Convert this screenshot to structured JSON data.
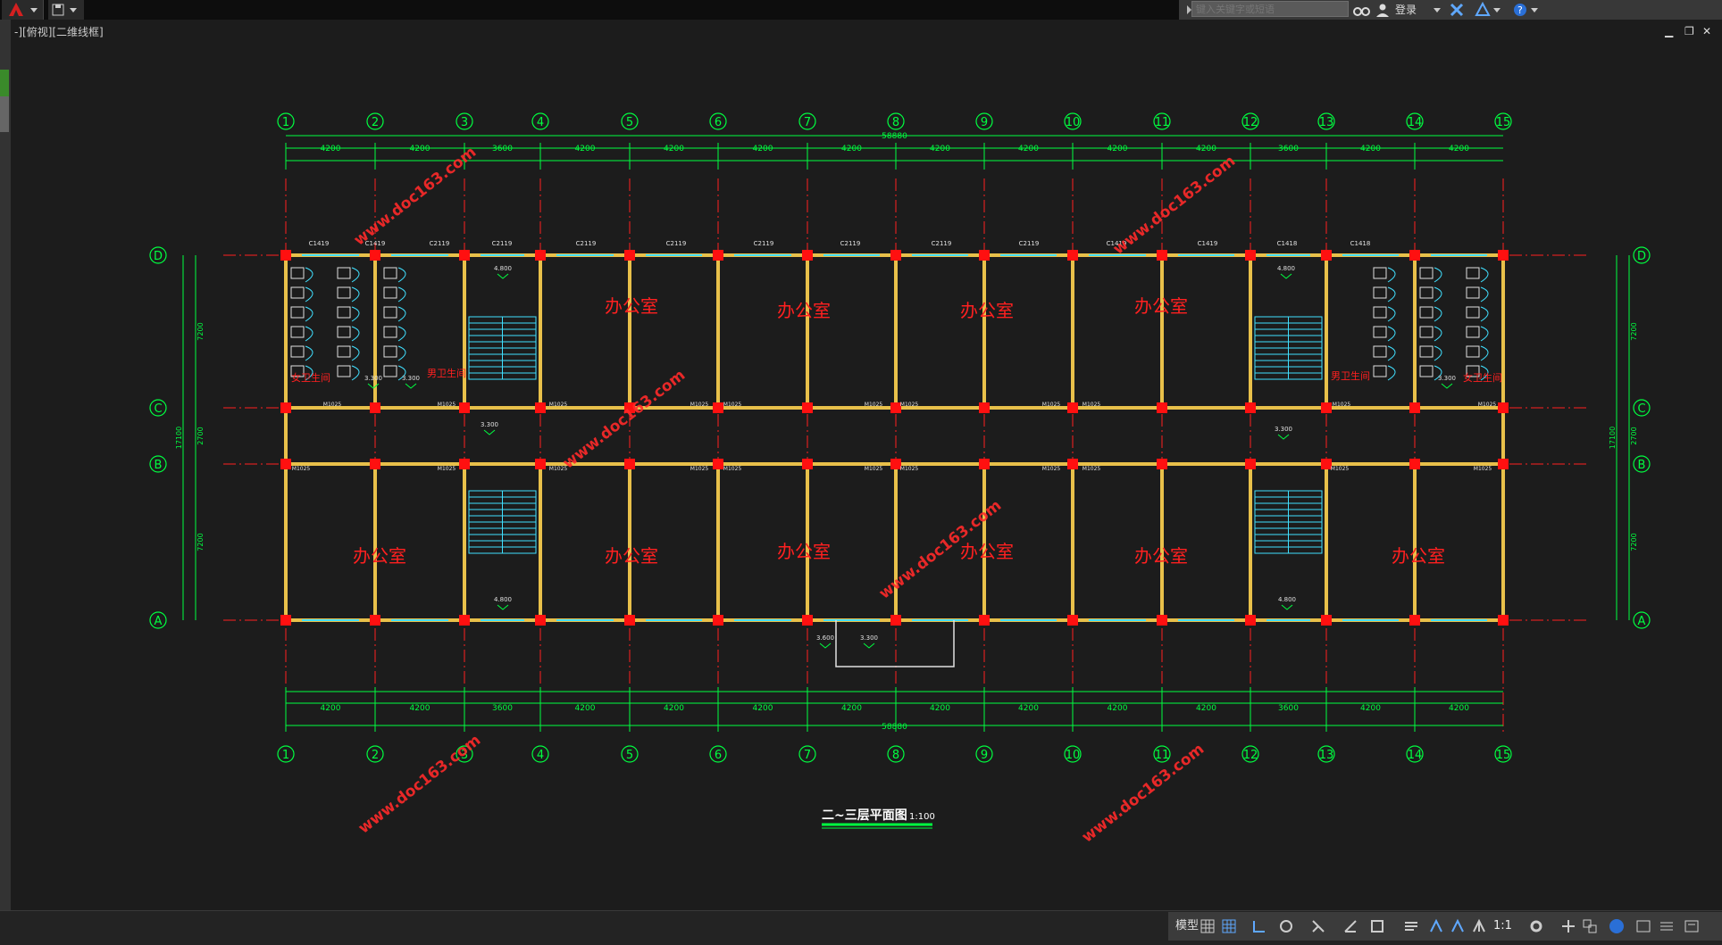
{
  "toolbar": {
    "search_placeholder": "键入关键字或短语",
    "login_label": "登录"
  },
  "viewport": {
    "label": "-][俯视][二维线框]"
  },
  "drawing": {
    "title": "二~三层平面图",
    "scale_text": "1:100",
    "grid_columns": [
      "1",
      "2",
      "3",
      "4",
      "5",
      "6",
      "7",
      "8",
      "9",
      "10",
      "11",
      "12",
      "13",
      "14",
      "15"
    ],
    "grid_rows": [
      "D",
      "C",
      "B",
      "A"
    ],
    "room_office": "办公室",
    "room_female_wc": "女卫生间",
    "room_male_wc": "男卫生间",
    "total_length": "58880",
    "top_dims_major": [
      "4200",
      "4200",
      "3600",
      "4200",
      "4200",
      "4200",
      "4200",
      "4200",
      "4200",
      "4200",
      "4200",
      "3600",
      "4200",
      "4200"
    ],
    "bottom_dims_major": [
      "4200",
      "4200",
      "3600",
      "4200",
      "4200",
      "4200",
      "4200",
      "4200",
      "4200",
      "4200",
      "4200",
      "3600",
      "4200",
      "4200"
    ],
    "left_dims": [
      "7200",
      "2700",
      "7200"
    ],
    "left_total": "17100",
    "right_dims": [
      "7200",
      "2700",
      "7200"
    ],
    "right_total": "17100",
    "level_labels": [
      "4.800",
      "3.300",
      "3.300",
      "4.800",
      "3.300",
      "3.300",
      "3.600",
      "3.300",
      "4.800",
      "3.300",
      "4.800"
    ],
    "window_labels": [
      "C1419",
      "C1419",
      "C2119",
      "C2119",
      "C2119",
      "C2119",
      "C2119",
      "C2119",
      "C2119",
      "C2119",
      "C1419",
      "C1419",
      "C1418",
      "C1418"
    ],
    "door_label": "M1025",
    "watermark": "www.doc163.com"
  },
  "statusbar": {
    "model_label": "模型",
    "scale_label": "1:1"
  },
  "colors": {
    "axis_line": "#ff2020",
    "column": "#ff1010",
    "wall": "#e8c04a",
    "grid_text": "#00ff40",
    "dim_text": "#00ff40",
    "fixture": "#40e0ff",
    "room_text": "#ff2020",
    "watermark": "#ff2a2a"
  }
}
